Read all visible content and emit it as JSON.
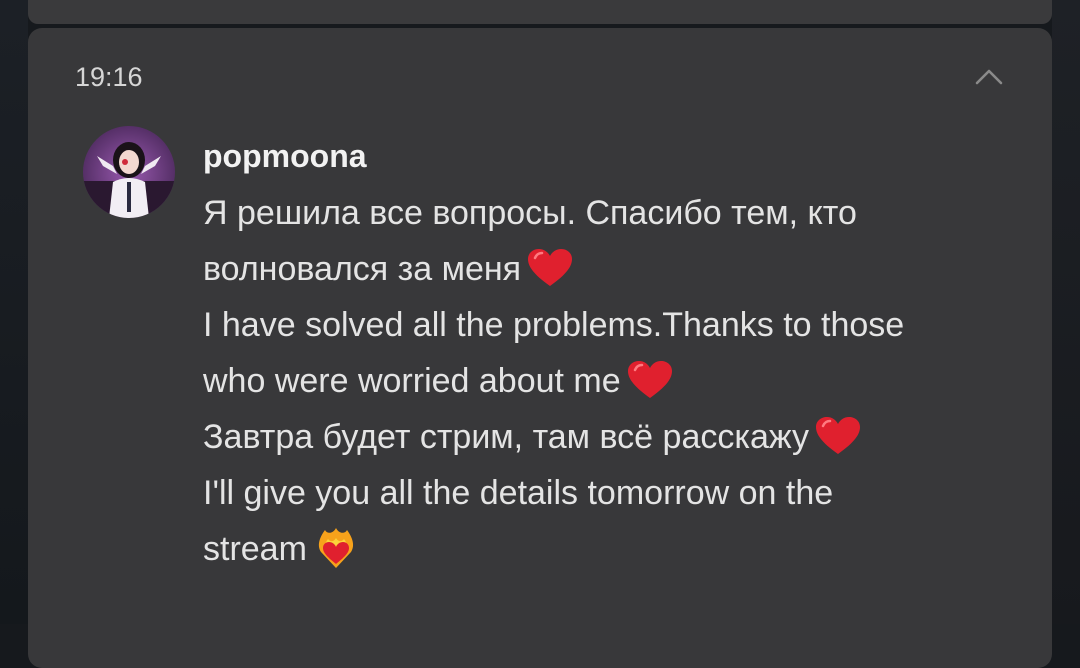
{
  "notification": {
    "time": "19:16",
    "username": "popmoona",
    "lines": [
      "Я решила все вопросы. Спасибо тем, кто",
      "волновался за меня",
      "I have solved all the problems.Thanks to those",
      "who were worried about me",
      "Завтра будет стрим, там всё расскажу",
      "I'll give you all the details tomorrow on the",
      "stream"
    ]
  },
  "icons": {
    "collapse": "chevron-up-icon",
    "heart": "red-heart-emoji",
    "flame_heart": "heart-on-fire-emoji"
  },
  "colors": {
    "card": "#38383a",
    "heart": "#e0202e",
    "text": "#e4e4e4"
  }
}
